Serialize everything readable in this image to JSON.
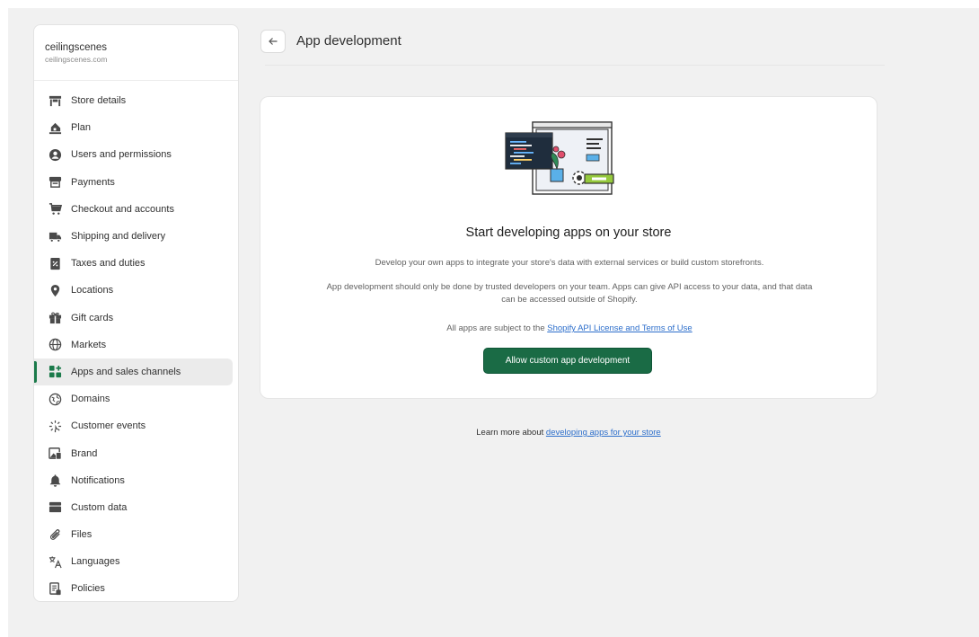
{
  "store": {
    "name": "ceilingscenes",
    "domain": "ceilingscenes.com"
  },
  "sidebar": {
    "items": [
      {
        "label": "Store details",
        "icon": "store-icon"
      },
      {
        "label": "Plan",
        "icon": "plan-icon"
      },
      {
        "label": "Users and permissions",
        "icon": "user-icon"
      },
      {
        "label": "Payments",
        "icon": "payments-icon"
      },
      {
        "label": "Checkout and accounts",
        "icon": "cart-icon"
      },
      {
        "label": "Shipping and delivery",
        "icon": "truck-icon"
      },
      {
        "label": "Taxes and duties",
        "icon": "tax-icon"
      },
      {
        "label": "Locations",
        "icon": "location-pin-icon"
      },
      {
        "label": "Gift cards",
        "icon": "gift-icon"
      },
      {
        "label": "Markets",
        "icon": "globe-icon"
      },
      {
        "label": "Apps and sales channels",
        "icon": "apps-icon",
        "active": true
      },
      {
        "label": "Domains",
        "icon": "domains-icon"
      },
      {
        "label": "Customer events",
        "icon": "sparkle-icon"
      },
      {
        "label": "Brand",
        "icon": "brand-icon"
      },
      {
        "label": "Notifications",
        "icon": "bell-icon"
      },
      {
        "label": "Custom data",
        "icon": "database-icon"
      },
      {
        "label": "Files",
        "icon": "paperclip-icon"
      },
      {
        "label": "Languages",
        "icon": "translate-icon"
      },
      {
        "label": "Policies",
        "icon": "document-icon"
      }
    ]
  },
  "header": {
    "title": "App development",
    "back_icon": "arrow-left-icon"
  },
  "card": {
    "heading": "Start developing apps on your store",
    "description": "Develop your own apps to integrate your store's data with external services or build custom storefronts.",
    "warning": "App development should only be done by trusted developers on your team. Apps can give API access to your data, and that data can be accessed outside of Shopify.",
    "terms_prefix": "All apps are subject to the ",
    "terms_link": "Shopify API License and Terms of Use",
    "button_label": "Allow custom app development"
  },
  "footer": {
    "learn_prefix": "Learn more about ",
    "learn_link": "developing apps for your store"
  },
  "colors": {
    "accent": "#1a6b45",
    "active_indicator": "#1a7a4a",
    "link": "#2c6ecb",
    "background": "#f1f1f1"
  }
}
